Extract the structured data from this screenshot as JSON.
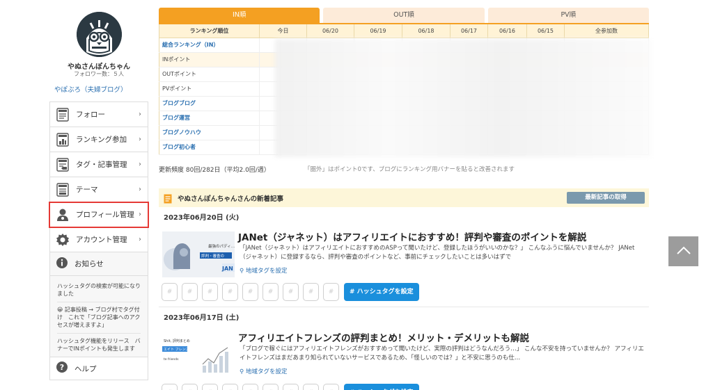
{
  "profile": {
    "name": "やぬさんぽんちゃん",
    "followers": "フォロワー数：５人",
    "blog_link": "やぽぶろ（夫婦ブログ）"
  },
  "menu": [
    {
      "label": "フォロー",
      "icon": "follow-icon"
    },
    {
      "label": "ランキング参加",
      "icon": "ranking-icon"
    },
    {
      "label": "タグ・記事管理",
      "icon": "tag-icon"
    },
    {
      "label": "テーマ",
      "icon": "theme-icon"
    },
    {
      "label": "プロフィール管理",
      "icon": "profile-icon",
      "highlighted": true
    },
    {
      "label": "アカウント管理",
      "icon": "gear-icon"
    }
  ],
  "notices": {
    "title": "お知らせ",
    "entries": [
      "ハッシュタグの検索が可能になりました",
      "😀 記事投稿 → ブログ村でタグ付け　これで「ブログ記事へのアクセスが増えますよ」",
      "ハッシュタグ機能をリリース　バナーでINポイントも発生します"
    ]
  },
  "help_label": "ヘルプ",
  "tabs": [
    {
      "label": "IN順",
      "active": true
    },
    {
      "label": "OUT順",
      "active": false
    },
    {
      "label": "PV順",
      "active": false
    }
  ],
  "ranking_table": {
    "headers": [
      "ランキング順位",
      "今日",
      "06/20",
      "06/19",
      "06/18",
      "06/17",
      "06/16",
      "06/15",
      "全参加数"
    ],
    "rows": [
      {
        "label": "総合ランキング（IN）",
        "link": true
      },
      {
        "label": "INポイント",
        "link": false
      },
      {
        "label": "OUTポイント",
        "link": false
      },
      {
        "label": "PVポイント",
        "link": false
      },
      {
        "label": "ブログブログ",
        "link": true
      },
      {
        "label": "ブログ運営",
        "link": true
      },
      {
        "label": "ブログノウハウ",
        "link": true
      },
      {
        "label": "ブログ初心者",
        "link": true
      }
    ]
  },
  "update_frequency": "更新頻度 80回/282日（平均2.0回/週）",
  "frequency_note": "「圏外」はポイント0です、ブログにランキング用バナーを貼ると改善されます",
  "articles_section": {
    "title": "やぬさんぽんちゃんさんの新着記事",
    "fetch_button": "最新記事の取得"
  },
  "articles": [
    {
      "date": "2023年06月20日 (火)",
      "title": "JANet（ジャネット）はアフィリエイトにおすすめ！評判や審査のポイントを解説",
      "excerpt": "「JANet（ジャネット）はアフィリエイトにおすすめのASPって聞いたけど、登録したほうがいいのかな？」 こんなふうに悩んでいませんか？ JANet（ジャネット）に登録するなら、評判や審査のポイントなど、事前にチェックしたいことは多いはずで",
      "area_tag": "地域タグを設定",
      "hashtag_button": "# ハッシュタグを設定"
    },
    {
      "date": "2023年06月17日 (土)",
      "title": "アフィリエイトフレンズの評判まとめ！メリット・デメリットも解説",
      "excerpt": "「ブログで稼ぐにはアフィリエイトフレンズがおすすめって聞いたけど、実際の評判はどうなんだろう…」 こんな不安を持っていませんか？ アフィリエイトフレンズはまだあまり知られていないサービスであるため、「怪しいのでは？」と不安に思うのも仕…",
      "area_tag": "地域タグを設定",
      "hashtag_button": "# ハッシュタグを設定"
    }
  ],
  "hash_placeholder": "#"
}
